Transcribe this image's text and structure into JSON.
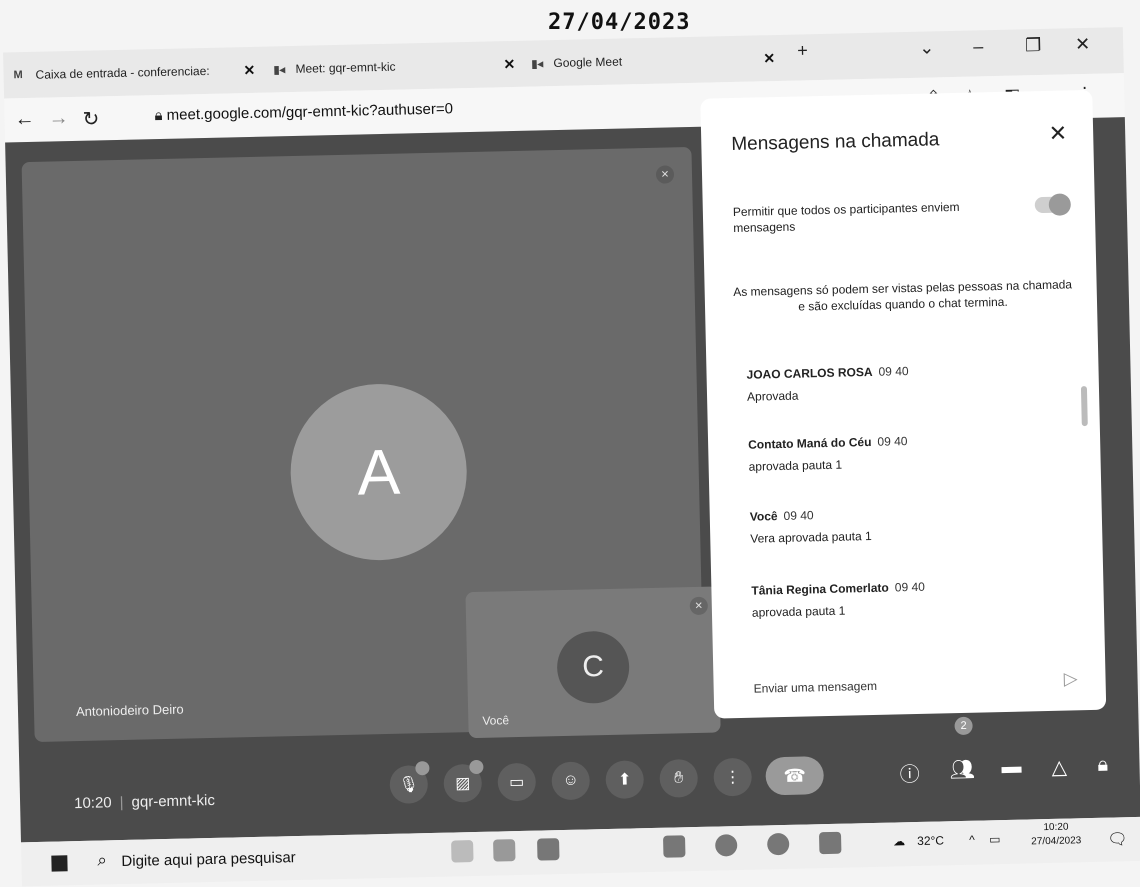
{
  "stamp_date": "27/04/2023",
  "browser": {
    "tabs": [
      {
        "label": "Caixa de entrada - conferenciae:",
        "icon": "gmail-icon"
      },
      {
        "label": "Meet: gqr-emnt-kic",
        "icon": "meet-icon"
      },
      {
        "label": "Google Meet",
        "icon": "meet-icon"
      }
    ],
    "url": "meet.google.com/gqr-emnt-kic?authuser=0",
    "window_controls": [
      "chevron-down-icon",
      "minimize-icon",
      "restore-icon",
      "close-icon"
    ]
  },
  "meeting": {
    "main_tile": {
      "initial": "A",
      "name": "Antoniodeiro Deiro"
    },
    "self_tile": {
      "initial": "C",
      "name": "Você"
    },
    "time": "10:20",
    "code": "gqr-emnt-kic",
    "people_badge": "2"
  },
  "chat": {
    "title": "Mensagens na chamada",
    "permission_label": "Permitir que todos os participantes enviem mensagens",
    "info": "As mensagens só podem ser vistas pelas pessoas na chamada e são excluídas quando o chat termina.",
    "messages": [
      {
        "sender": "JOAO CARLOS ROSA",
        "time": "09 40",
        "text": "Aprovada"
      },
      {
        "sender": "Contato Maná do Céu",
        "time": "09 40",
        "text": "aprovada pauta 1"
      },
      {
        "sender": "Você",
        "time": "09 40",
        "text": "Vera aprovada pauta 1"
      },
      {
        "sender": "Tânia Regina Comerlato",
        "time": "09 40",
        "text": "aprovada pauta 1"
      }
    ],
    "input_placeholder": "Enviar uma mensagem"
  },
  "taskbar": {
    "search_placeholder": "Digite aqui para pesquisar",
    "temperature": "32°C",
    "clock_time": "10:20",
    "clock_date": "27/04/2023"
  },
  "colors": {
    "meet_bg": "#4b4b4b",
    "panel_bg": "#ffffff"
  }
}
